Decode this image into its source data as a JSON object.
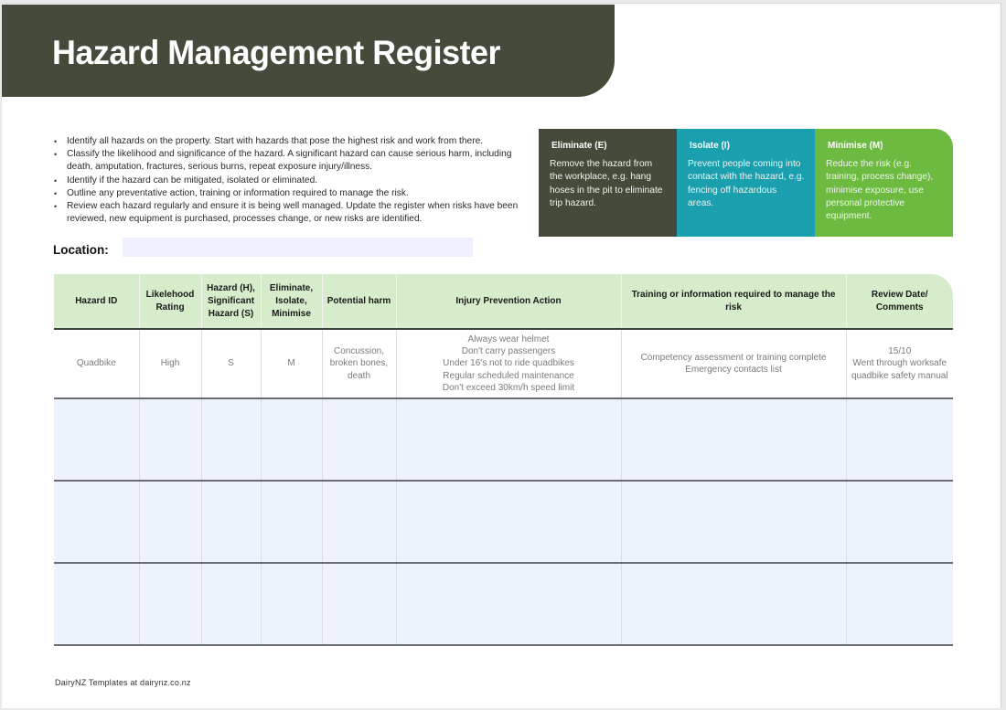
{
  "title": "Hazard Management Register",
  "instructions": [
    "Identify all hazards on the property.  Start with hazards that pose the highest risk and work from there.",
    "Classify the likelihood and significance of the hazard. A significant hazard can cause serious harm, including death, amputation, fractures, serious burns, repeat exposure injury/illness.",
    "Identify if the hazard can be mitigated, isolated or eliminated.",
    "Outline any preventative action, training or information required to manage the risk.",
    "Review each hazard regularly and ensure it is being well managed. Update the register when risks have been reviewed, new equipment is purchased, processes change, or new risks are identified."
  ],
  "info_boxes": [
    {
      "title": "Eliminate (E)",
      "description": "Remove the hazard from the workplace, e.g. hang hoses in the pit to eliminate trip hazard.",
      "color": "#444b3b"
    },
    {
      "title": "Isolate (I)",
      "description": "Prevent people coming into contact with the hazard, e.g. fencing off hazardous areas.",
      "color": "#1a9fae"
    },
    {
      "title": "Minimise (M)",
      "description": "Reduce the risk (e.g. training, process change), minimise exposure, use personal protective equipment.",
      "color": "#6cba3f"
    }
  ],
  "location": {
    "label": "Location:",
    "value": ""
  },
  "table": {
    "columns": [
      "Hazard ID",
      "Likelehood Rating",
      "Hazard (H), Significant Hazard (S)",
      "Eliminate, Isolate, Minimise",
      "Potential harm",
      "Injury Prevention Action",
      "Training or information required to manage the risk",
      "Review Date/ Comments"
    ],
    "example_row": {
      "hazard_id": "Quadbike",
      "likelihood": "High",
      "hazard_type": "S",
      "control": "M",
      "potential_harm": "Concussion, broken bones, death",
      "prevention_actions": [
        "Always wear helmet",
        "Don't carry passengers",
        "Under 16's not to ride quadbikes",
        "Regular scheduled maintenance",
        "Don't exceed 30km/h speed limit"
      ],
      "training": [
        "Competency assessment or training complete",
        "Emergency contacts list"
      ],
      "review": [
        "15/10",
        "Went through worksafe quadbike safety manual"
      ]
    },
    "blank_rows": 3
  },
  "footer": "DairyNZ Templates at dairynz.co.nz",
  "colors": {
    "banner": "#444b3b",
    "header_green": "#d6eccb",
    "blank_row": "#eef2fd"
  }
}
